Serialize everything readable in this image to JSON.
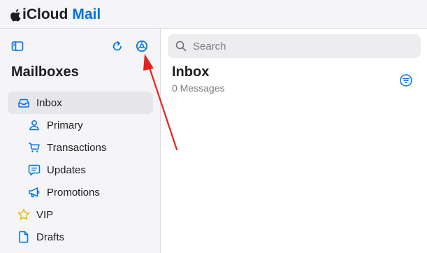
{
  "header": {
    "brand": "iCloud",
    "app": "Mail"
  },
  "sidebar": {
    "title": "Mailboxes",
    "items": [
      {
        "label": "Inbox",
        "icon": "inbox-icon",
        "selected": true
      },
      {
        "label": "Primary",
        "icon": "person-icon"
      },
      {
        "label": "Transactions",
        "icon": "cart-icon"
      },
      {
        "label": "Updates",
        "icon": "message-icon"
      },
      {
        "label": "Promotions",
        "icon": "megaphone-icon"
      },
      {
        "label": "VIP",
        "icon": "star-icon"
      },
      {
        "label": "Drafts",
        "icon": "document-icon"
      }
    ]
  },
  "main": {
    "search_placeholder": "Search",
    "title": "Inbox",
    "count": "0 Messages"
  },
  "colors": {
    "accent": "#0071e3",
    "arrow": "#e8211b",
    "vip_star": "#e6b800"
  }
}
